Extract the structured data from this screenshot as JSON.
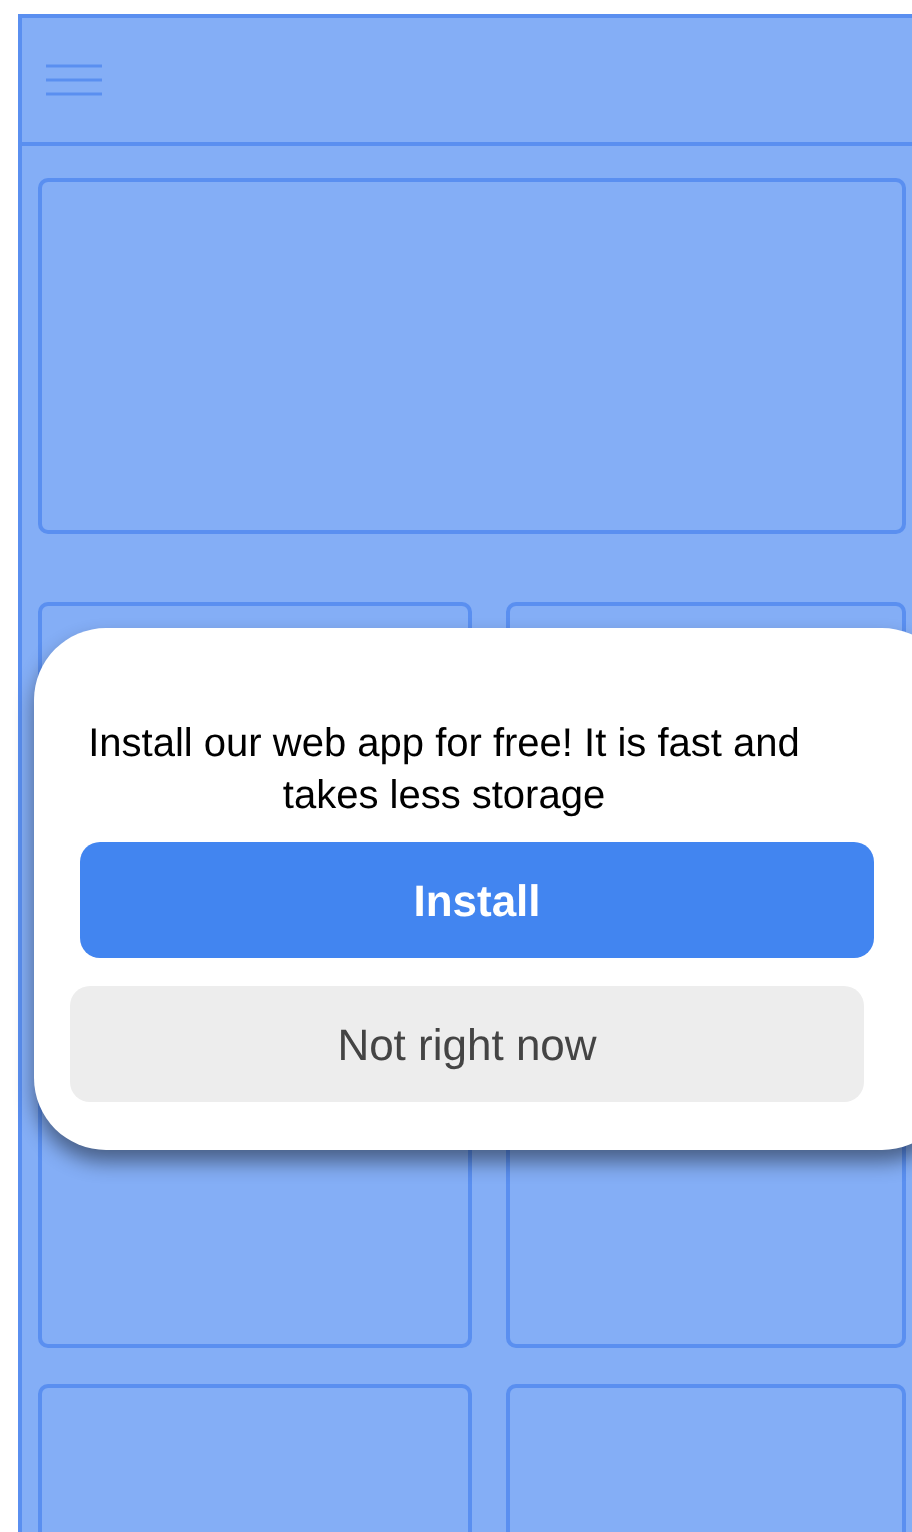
{
  "dialog": {
    "message": "Install our web app for free! It is fast and takes less storage",
    "buttons": [
      {
        "label": "Install",
        "kind": "primary"
      },
      {
        "label": "Not right now",
        "kind": "secondary"
      }
    ]
  }
}
